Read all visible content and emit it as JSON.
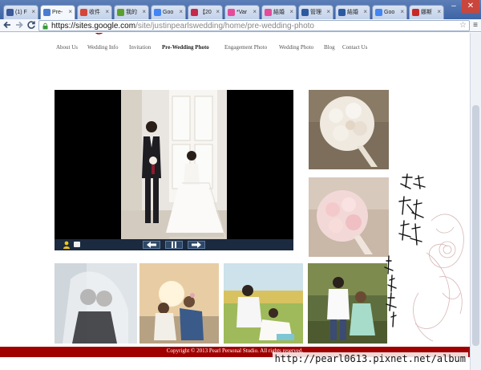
{
  "browser": {
    "tabs": [
      {
        "label": "(1) F",
        "fav_color": "#3b5998",
        "active": false
      },
      {
        "label": "Pre-",
        "fav_color": "#4a7bd4",
        "active": true
      },
      {
        "label": "收件",
        "fav_color": "#d44638",
        "active": false
      },
      {
        "label": "我的",
        "fav_color": "#5aa02c",
        "active": false
      },
      {
        "label": "Goo",
        "fav_color": "#4285f4",
        "active": false
      },
      {
        "label": "【20",
        "fav_color": "#c6284a",
        "active": false
      },
      {
        "label": "*Var",
        "fav_color": "#e44b9a",
        "active": false
      },
      {
        "label": "結婚",
        "fav_color": "#e44b9a",
        "active": false
      },
      {
        "label": "管理",
        "fav_color": "#2c5aa0",
        "active": false
      },
      {
        "label": "結婚",
        "fav_color": "#2c5aa0",
        "active": false
      },
      {
        "label": "Goo",
        "fav_color": "#4285f4",
        "active": false
      },
      {
        "label": "娜斯",
        "fav_color": "#c62828",
        "active": false
      }
    ],
    "window_controls": {
      "minimize": "–",
      "maximize": "□",
      "close": "✕"
    },
    "url_host": "https://sites.google.com",
    "url_path": "/site/justinpearlswedding/home/pre-wedding-photo"
  },
  "site": {
    "nav": [
      {
        "label": "About Us",
        "current": false
      },
      {
        "label": "Wedding Info",
        "current": false
      },
      {
        "label": "Invitation",
        "current": false
      },
      {
        "label": "Pre-Wedding Photo",
        "current": true
      },
      {
        "label": "Engagement Photo",
        "current": false
      },
      {
        "label": "Wedding Photo",
        "current": false
      },
      {
        "label": "Blog",
        "current": false
      },
      {
        "label": "Contact Us",
        "current": false
      }
    ],
    "slideshow_controls": {
      "prev": "◀",
      "pause": "❚❚",
      "next": "▶"
    },
    "footer": "Copyright © 2013 Pearl Personal Studio. All rights reserved.",
    "watermark": "http://pearl0613.pixnet.net/album"
  },
  "colors": {
    "footer_red": "#a00000",
    "tab_bar": "#3d64a6"
  }
}
